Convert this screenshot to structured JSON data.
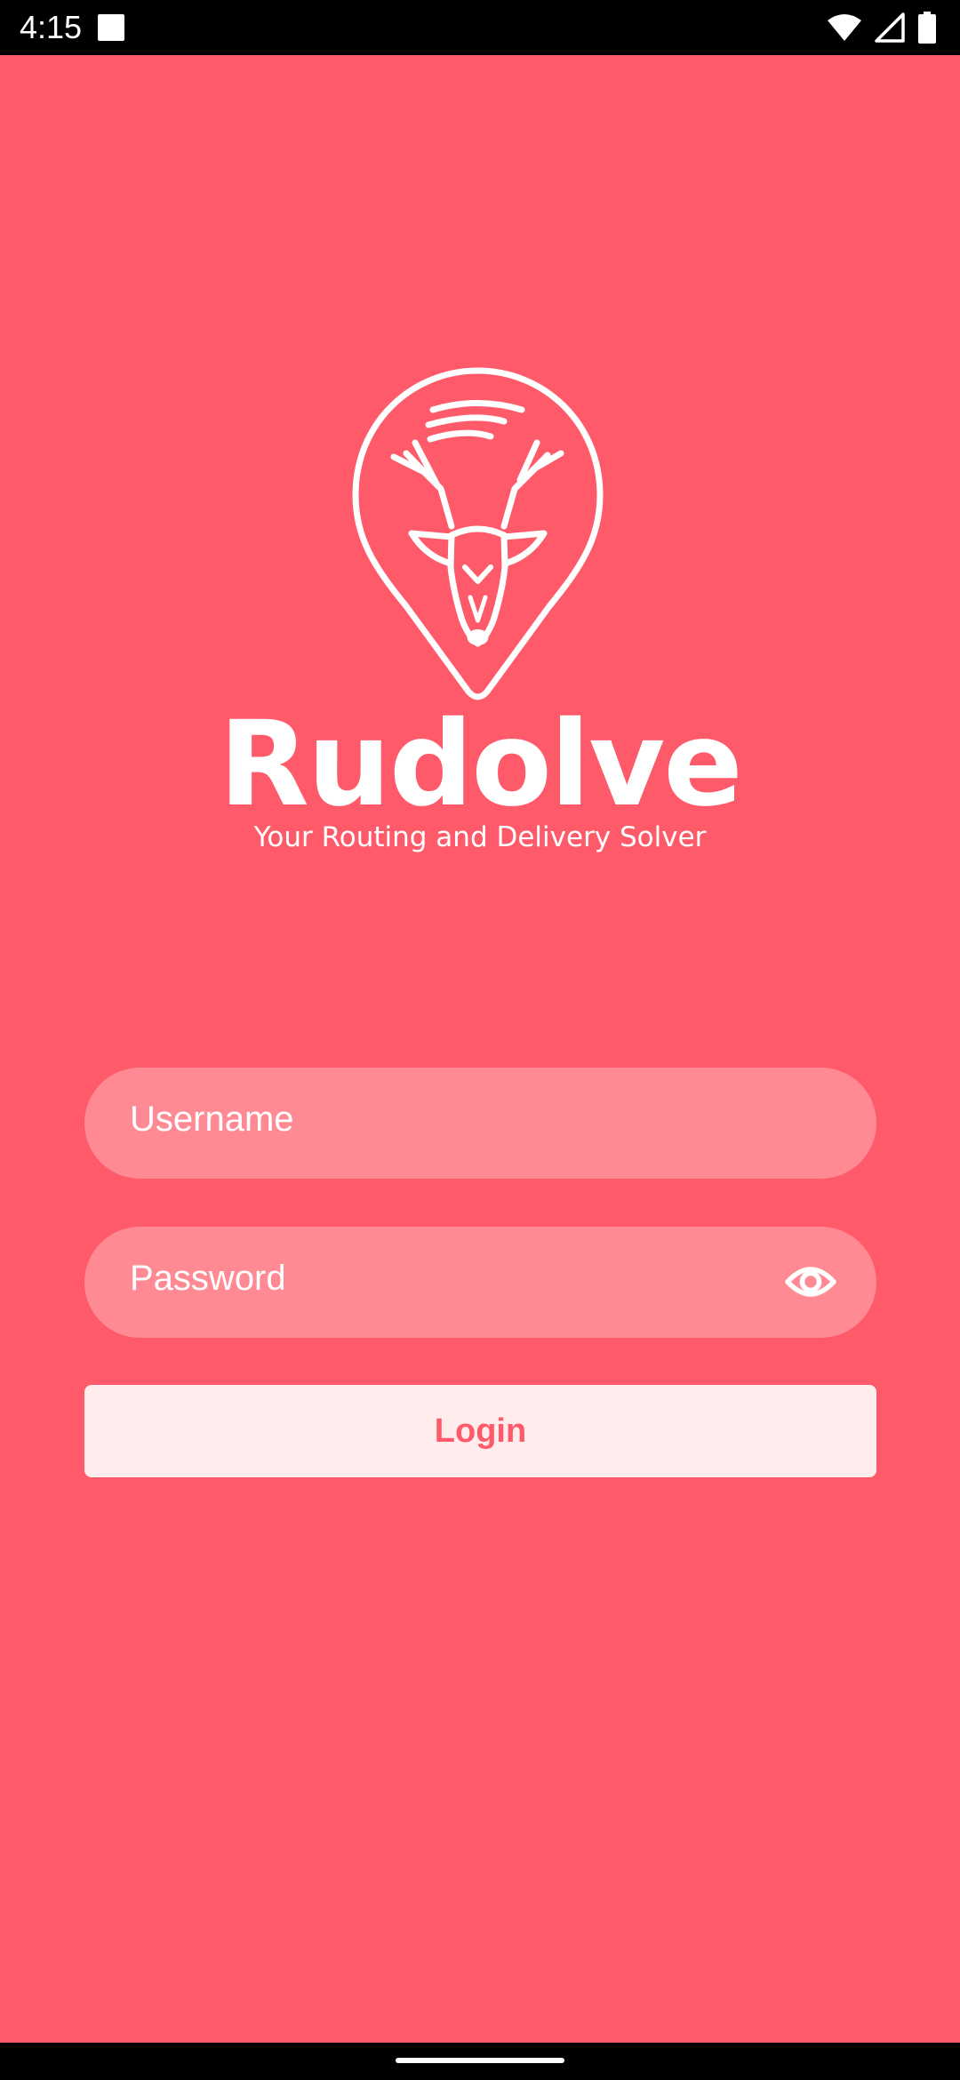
{
  "status_bar": {
    "time": "4:15",
    "icons": [
      "notification-square-icon",
      "wifi-icon",
      "signal-icon",
      "battery-icon"
    ]
  },
  "brand": {
    "name": "Rudolve",
    "tagline": "Your Routing and Delivery Solver",
    "logo": "reindeer-location-pin-icon"
  },
  "form": {
    "username": {
      "value": "",
      "placeholder": "Username"
    },
    "password": {
      "value": "",
      "placeholder": "Password",
      "toggle_icon": "eye-icon"
    },
    "login_label": "Login"
  },
  "colors": {
    "background": "#ff5a69",
    "field_fill": "#ff8a94",
    "button_fill": "#ffeced",
    "button_text": "#ff5a69",
    "foreground": "#ffffff"
  }
}
